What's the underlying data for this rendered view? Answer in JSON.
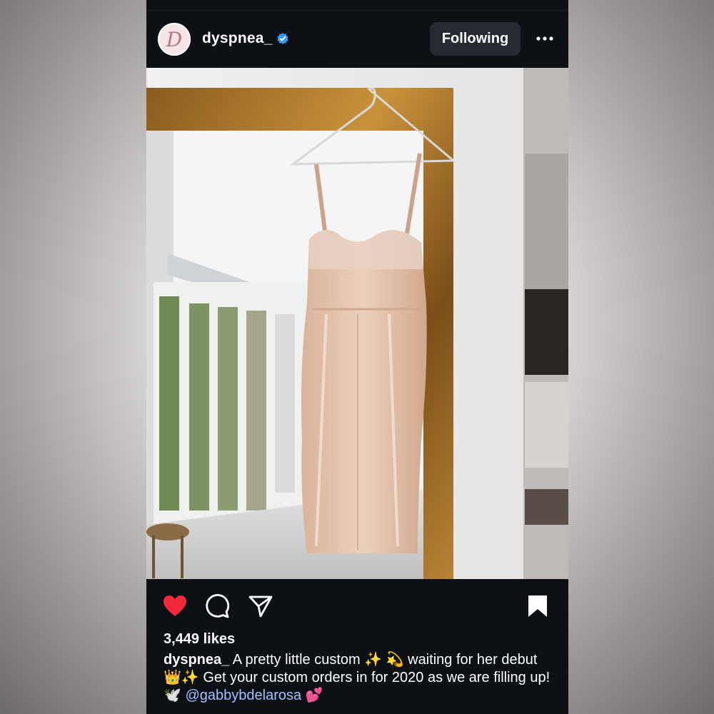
{
  "post": {
    "username": "dyspnea_",
    "avatar_letter": "D",
    "follow_button": "Following",
    "more_icon": "more-horizontal-icon",
    "likes": "3,449 likes",
    "caption": {
      "username": "dyspnea_",
      "text_1": " A pretty little custom ✨ 💫 waiting for her debut 👑✨ Get your custom orders in for 2020 as we are filling up! 🕊️ ",
      "mention": "@gabbybdelarosa",
      "text_2": " 💕"
    }
  },
  "icons": {
    "like": "heart-filled-icon",
    "comment": "comment-icon",
    "share": "paper-plane-icon",
    "save": "bookmark-filled-icon",
    "verified": "verified-badge-icon"
  },
  "colors": {
    "background": "#0d1015",
    "like_red": "#f2293a",
    "verified_blue": "#3897f0",
    "mention": "#9ec2ff",
    "button_bg": "#262a31"
  }
}
